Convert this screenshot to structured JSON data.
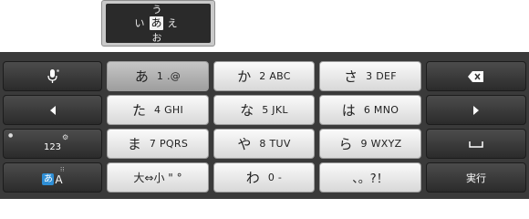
{
  "popup": {
    "up": "う",
    "left": "い",
    "center": "あ",
    "right": "え",
    "down": "お"
  },
  "keys": {
    "a": {
      "kana": "あ",
      "sub": "1 .@"
    },
    "ka": {
      "kana": "か",
      "sub": "2 ABC"
    },
    "sa": {
      "kana": "さ",
      "sub": "3 DEF"
    },
    "ta": {
      "kana": "た",
      "sub": "4 GHI"
    },
    "na": {
      "kana": "な",
      "sub": "5 JKL"
    },
    "ha": {
      "kana": "は",
      "sub": "6 MNO"
    },
    "ma": {
      "kana": "ま",
      "sub": "7 PQRS"
    },
    "ya": {
      "kana": "や",
      "sub": "8 TUV"
    },
    "ra": {
      "kana": "ら",
      "sub": "9 WXYZ"
    },
    "modifier": {
      "label": "大⇔小 \" °"
    },
    "wa": {
      "kana": "わ",
      "sub": "0 -"
    },
    "punct": {
      "label": "、。?！"
    },
    "mode_123": "123",
    "mode_kana_a": "あ",
    "mode_kana_b": "A",
    "enter": "実行"
  },
  "colors": {
    "keyboard_bg": "#3a3a3a",
    "light_key": "#f0f0f0",
    "dark_key": "#3c3c3c",
    "accent_blue": "#2f8fd6"
  }
}
